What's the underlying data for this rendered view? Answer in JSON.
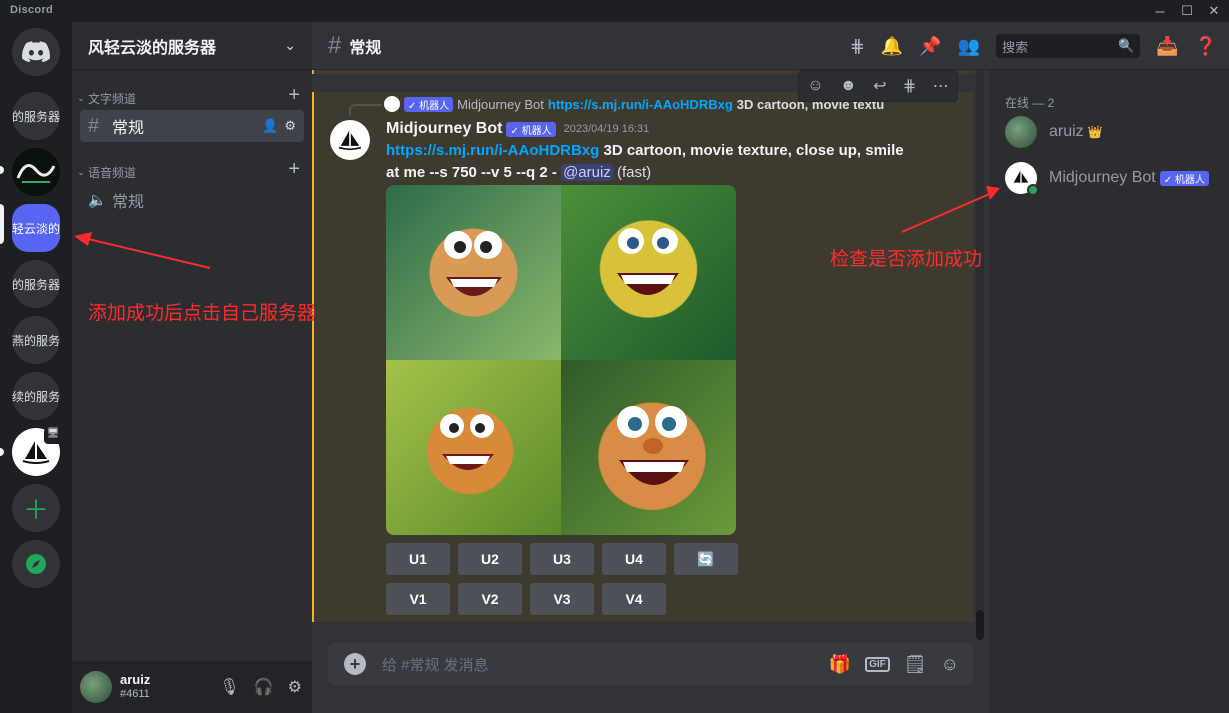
{
  "titlebar": {
    "brand": "Discord",
    "min": "─",
    "max": "☐",
    "close": "✕"
  },
  "rail": {
    "servers": [
      {
        "label": "的服务器"
      },
      {
        "label": ""
      },
      {
        "label": "轻云淡的服务"
      },
      {
        "label": "的服务器"
      },
      {
        "label": "燕的服务"
      },
      {
        "label": "续的服务"
      },
      {
        "label": ""
      }
    ]
  },
  "guild": {
    "name": "风轻云淡的服务器"
  },
  "channels": {
    "text_category": "文字频道",
    "text_channel": "常规",
    "voice_category": "语音频道",
    "voice_channel": "常规"
  },
  "user": {
    "name": "aruiz",
    "discriminator": "#4611"
  },
  "header": {
    "channel": "常规",
    "search_placeholder": "搜索"
  },
  "message": {
    "reply_tag": "✓ 机器人",
    "reply_author": "Midjourney Bot",
    "reply_link": "https://s.mj.run/i-AAoHDRBxg",
    "reply_text": "3D cartoon, movie textu",
    "author": "Midjourney Bot",
    "tag": "✓ 机器人",
    "timestamp": "2023/04/19 16:31",
    "link": "https://s.mj.run/i-AAoHDRBxg",
    "prompt_1": " 3D cartoon, movie texture, close up, smile",
    "prompt_2": "at me --s 750 --v 5 --q 2 - ",
    "mention": "@aruiz",
    "speed": " (fast)",
    "upscale_buttons": [
      "U1",
      "U2",
      "U3",
      "U4"
    ],
    "variation_buttons": [
      "V1",
      "V2",
      "V3",
      "V4"
    ],
    "reroll_icon": "🔄"
  },
  "composer": {
    "placeholder": "给 #常规 发消息"
  },
  "members": {
    "header": "在线 — 2",
    "list": [
      {
        "name": "aruiz",
        "badge": "👑"
      },
      {
        "name": "Midjourney Bot",
        "tag": "✓ 机器人"
      }
    ]
  },
  "annotations": {
    "left": "添加成功后点击自己服务器",
    "right": "检查是否添加成功"
  },
  "colors": {
    "accent": "#5865f2",
    "link": "#00a8fc",
    "annotation": "#ff2a2a",
    "highlight_bar": "#f0b232"
  }
}
